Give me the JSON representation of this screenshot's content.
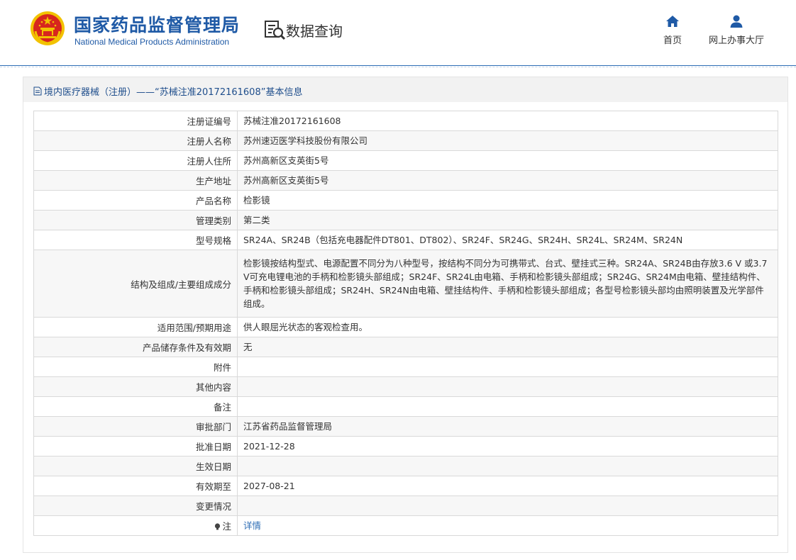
{
  "header": {
    "org_name_cn": "国家药品监督管理局",
    "org_name_en": "National Medical Products Administration",
    "query_title": "数据查询",
    "nav": [
      {
        "label": "首页",
        "icon": "home-icon"
      },
      {
        "label": "网上办事大厅",
        "icon": "user-icon"
      }
    ]
  },
  "panel": {
    "title": "境内医疗器械（注册）——“苏械注准20172161608”基本信息",
    "title_icon": "document-icon"
  },
  "rows": [
    {
      "label": "注册证编号",
      "value": "苏械注准20172161608"
    },
    {
      "label": "注册人名称",
      "value": "苏州速迈医学科技股份有限公司"
    },
    {
      "label": "注册人住所",
      "value": "苏州高新区支英街5号"
    },
    {
      "label": "生产地址",
      "value": "苏州高新区支英街5号"
    },
    {
      "label": "产品名称",
      "value": "检影镜"
    },
    {
      "label": "管理类别",
      "value": "第二类"
    },
    {
      "label": "型号规格",
      "value": "SR24A、SR24B（包括充电器配件DT801、DT802）、SR24F、SR24G、SR24H、SR24L、SR24M、SR24N"
    },
    {
      "label": "结构及组成/主要组成成分",
      "value": "检影镜按结构型式、电源配置不同分为八种型号，按结构不同分为可携带式、台式、壁挂式三种。SR24A、SR24B由存放3.6 V 或3.7 V可充电锂电池的手柄和检影镜头部组成；SR24F、SR24L由电箱、手柄和检影镜头部组成；SR24G、SR24M由电箱、壁挂结构件、手柄和检影镜头部组成；SR24H、SR24N由电箱、壁挂结构件、手柄和检影镜头部组成；各型号检影镜头部均由照明装置及光学部件组成。"
    },
    {
      "label": "适用范围/预期用途",
      "value": "供人眼屈光状态的客观检查用。"
    },
    {
      "label": "产品储存条件及有效期",
      "value": "无"
    },
    {
      "label": "附件",
      "value": ""
    },
    {
      "label": "其他内容",
      "value": ""
    },
    {
      "label": "备注",
      "value": ""
    },
    {
      "label": "审批部门",
      "value": "江苏省药品监督管理局"
    },
    {
      "label": "批准日期",
      "value": "2021-12-28"
    },
    {
      "label": "生效日期",
      "value": ""
    },
    {
      "label": "有效期至",
      "value": "2027-08-21"
    },
    {
      "label": "变更情况",
      "value": ""
    }
  ],
  "note_row": {
    "label": "注",
    "icon": "lightbulb-icon",
    "link_text": "详情"
  },
  "colors": {
    "brand_blue": "#1f5aa6",
    "link_blue": "#2d6db5",
    "emblem_red": "#d7261e",
    "emblem_gold": "#f2c200"
  }
}
